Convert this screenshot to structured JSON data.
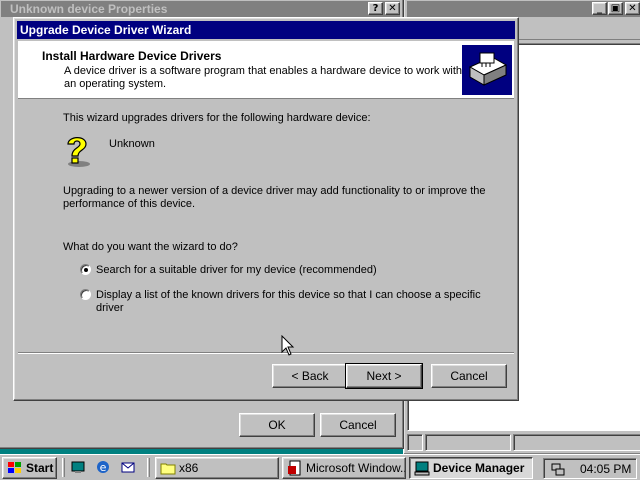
{
  "background_windows": {
    "properties_title": "Unknown device Properties",
    "ok_label": "OK",
    "cancel_label": "Cancel",
    "help_btn": "?",
    "close_btn": "✕",
    "devmgr_min": "_",
    "devmgr_max": "▣",
    "devmgr_close": "✕"
  },
  "wizard": {
    "title": "Upgrade Device Driver Wizard",
    "header_title": "Install Hardware Device Drivers",
    "header_subtitle": "A device driver is a software program that enables a hardware device to work with an operating system.",
    "intro": "This wizard upgrades drivers for the following hardware device:",
    "device_name": "Unknown",
    "upgrade_note": "Upgrading to a newer version of a device driver may add functionality to or improve the performance of this device.",
    "question": "What do you want the wizard to do?",
    "options": [
      {
        "label": "Search for a suitable driver for my device (recommended)",
        "selected": true
      },
      {
        "label": "Display a list of the known drivers for this device so that I can choose a specific driver",
        "selected": false
      }
    ],
    "back_label": "< Back",
    "next_label": "Next >",
    "cancel_label": "Cancel"
  },
  "taskbar": {
    "start_label": "Start",
    "tasks": [
      {
        "label": "x86",
        "icon": "folder-icon",
        "active": false
      },
      {
        "label": "Microsoft Window...",
        "icon": "document-icon",
        "active": false
      },
      {
        "label": "Device Manager",
        "icon": "computer-icon",
        "active": true
      }
    ],
    "clock": "04:05 PM"
  },
  "colors": {
    "desktop": "#008080",
    "active_title": "#000080",
    "inactive_title": "#808080",
    "face": "#c0c0c0"
  }
}
